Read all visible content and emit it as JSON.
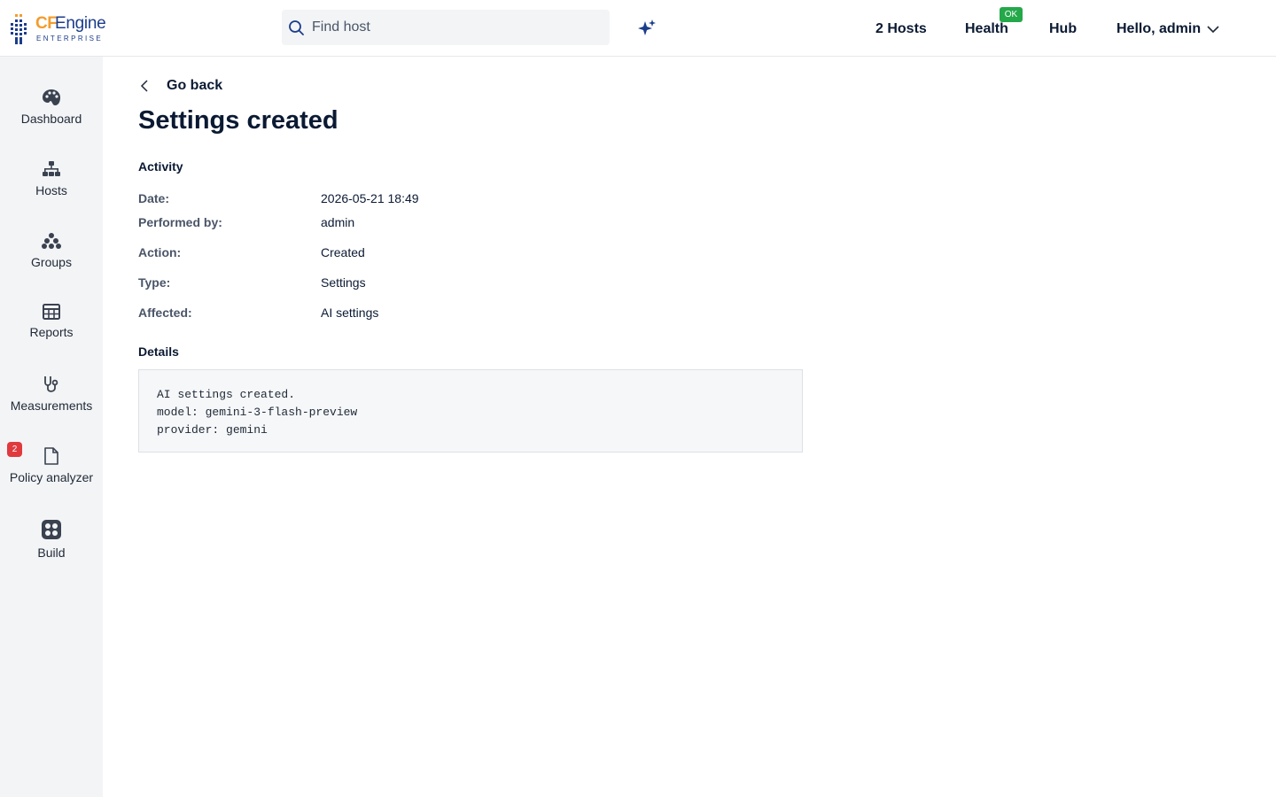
{
  "header": {
    "logo": {
      "brand_cf": "CF",
      "brand_engine": "Engine",
      "edition": "ENTERPRISE"
    },
    "search": {
      "placeholder": "Find host",
      "value": ""
    },
    "ai_icon": "sparkles-icon",
    "nav": {
      "hosts": "2 Hosts",
      "health": "Health",
      "health_status": "OK",
      "hub": "Hub",
      "user": "Hello, admin"
    }
  },
  "sidebar": {
    "items": [
      {
        "label": "Dashboard",
        "icon": "palette-icon"
      },
      {
        "label": "Hosts",
        "icon": "sitemap-icon"
      },
      {
        "label": "Groups",
        "icon": "dots-cluster-icon"
      },
      {
        "label": "Reports",
        "icon": "table-icon"
      },
      {
        "label": "Measurements",
        "icon": "stethoscope-icon"
      },
      {
        "label": "Policy analyzer",
        "icon": "file-icon",
        "badge": "2"
      },
      {
        "label": "Build",
        "icon": "build-grid-icon"
      }
    ]
  },
  "main": {
    "go_back": "Go back",
    "title": "Settings created",
    "activity_label": "Activity",
    "activity": {
      "date": {
        "key": "Date:",
        "value": "2026-05-21 18:49"
      },
      "performed_by": {
        "key": "Performed by:",
        "value": "admin"
      },
      "action": {
        "key": "Action:",
        "value": "Created"
      },
      "type": {
        "key": "Type:",
        "value": "Settings"
      },
      "affected": {
        "key": "Affected:",
        "value": "AI settings"
      }
    },
    "details_label": "Details",
    "details_text": "AI settings created.\nmodel: gemini-3-flash-preview\nprovider: gemini"
  },
  "colors": {
    "brand_orange": "#f39c2e",
    "brand_blue": "#1c3d8a",
    "ok_green": "#24a84a",
    "badge_red": "#e03a3e",
    "sidebar_bg": "#f3f4f6"
  }
}
